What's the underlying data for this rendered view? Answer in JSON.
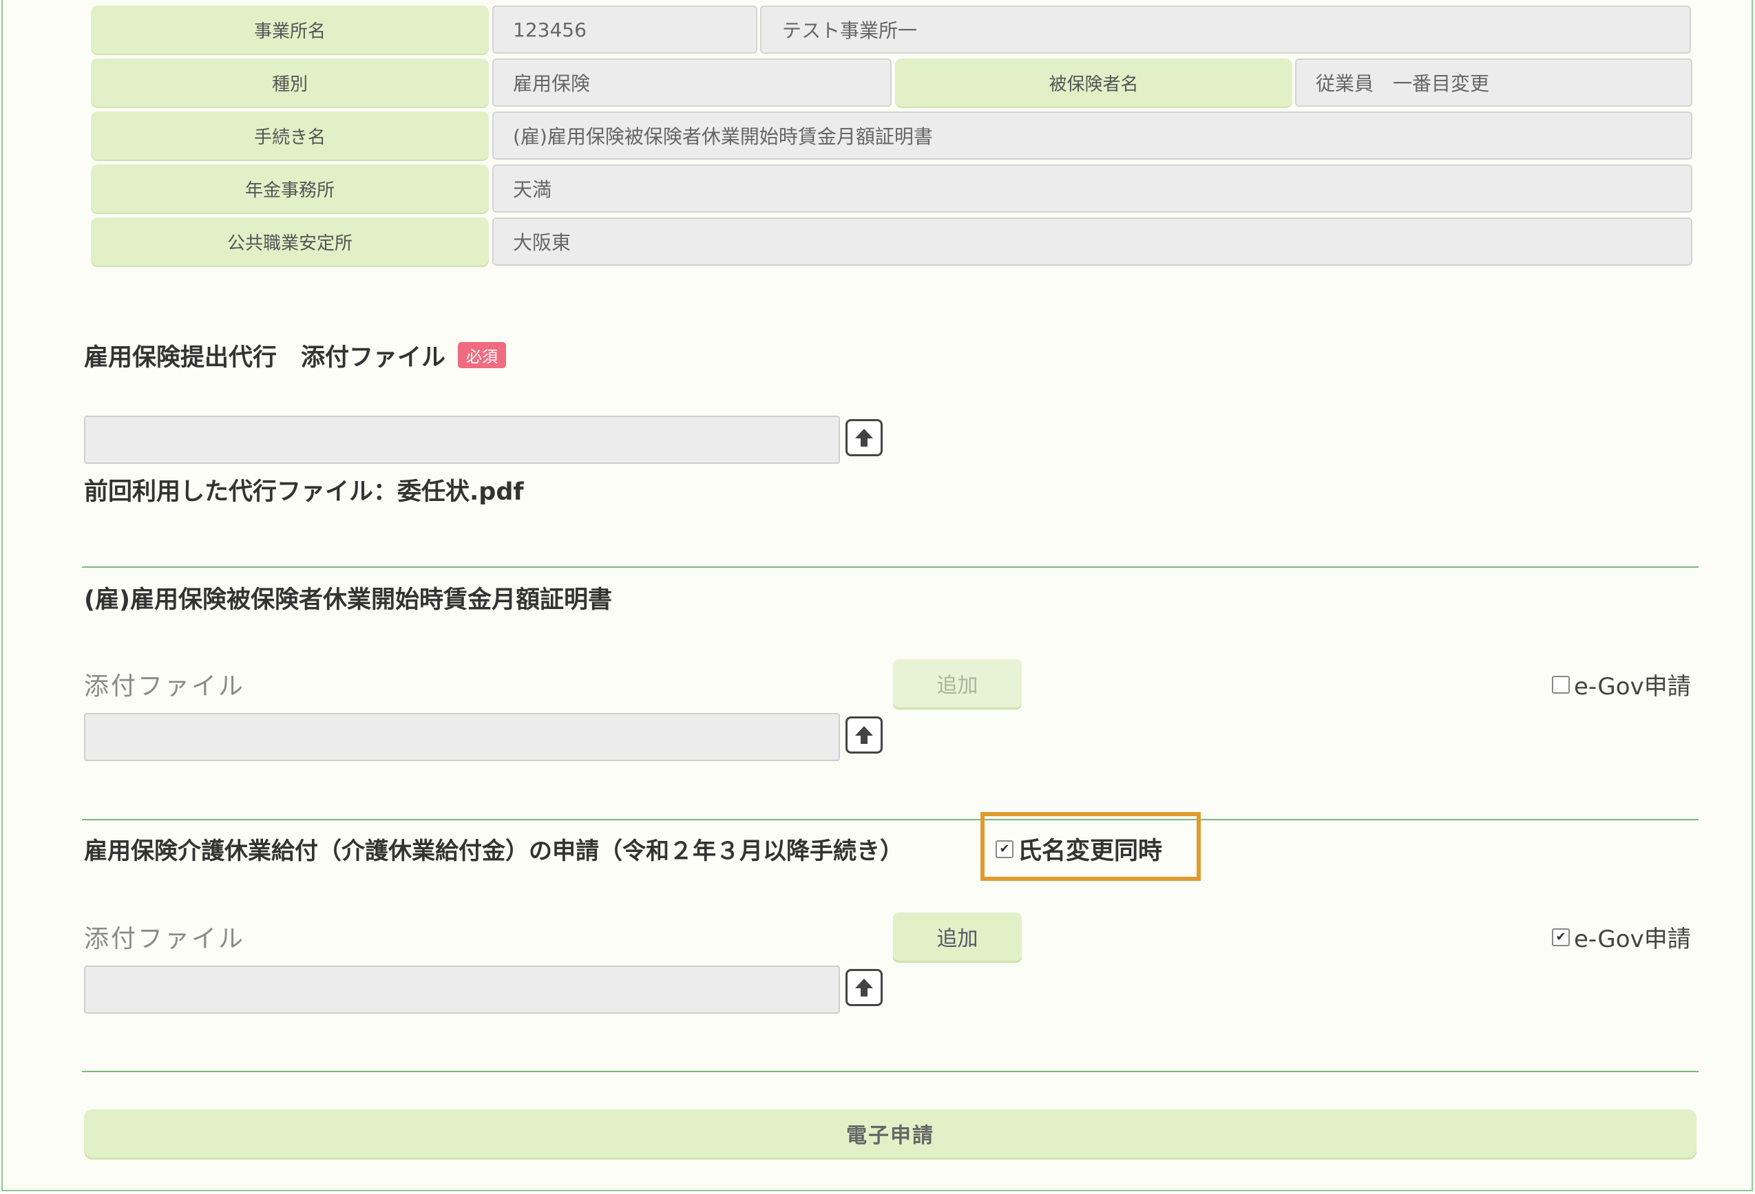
{
  "info": {
    "office_name_label": "事業所名",
    "office_code": "123456",
    "office_name": "テスト事業所一",
    "type_label": "種別",
    "type_value": "雇用保険",
    "insured_label": "被保険者名",
    "insured_value": "従業員　一番目変更",
    "procedure_label": "手続き名",
    "procedure_value": "(雇)雇用保険被保険者休業開始時賃金月額証明書",
    "pension_office_label": "年金事務所",
    "pension_office_value": "天満",
    "employment_office_label": "公共職業安定所",
    "employment_office_value": "大阪東"
  },
  "proxy": {
    "title": "雇用保険提出代行　添付ファイル",
    "required_badge": "必須",
    "previous_file": "前回利用した代行ファイル：委任状.pdf"
  },
  "section1": {
    "title": "(雇)雇用保険被保険者休業開始時賃金月額証明書",
    "attach_label": "添付ファイル",
    "add_label": "追加",
    "egov_label": "e-Gov申請",
    "egov_checked": false
  },
  "section2": {
    "title": "雇用保険介護休業給付（介護休業給付金）の申請（令和２年３月以降手続き）",
    "name_change_label": "氏名変更同時",
    "name_change_checked": true,
    "attach_label": "添付ファイル",
    "add_label": "追加",
    "egov_label": "e-Gov申請",
    "egov_checked": true
  },
  "submit_label": "電子申請",
  "colors": {
    "label_bg": "#e2f0c7",
    "highlight": "#e19a30",
    "badge": "#f06b80",
    "divider": "#7ab87a"
  }
}
